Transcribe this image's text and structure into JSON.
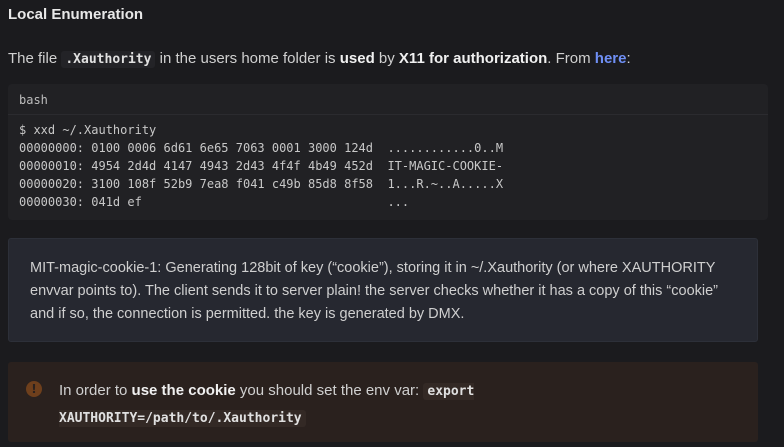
{
  "section": {
    "title": "Local Enumeration"
  },
  "intro": {
    "t1": "The file ",
    "code": ".Xauthority",
    "t2": " in the users home folder is ",
    "b1": "used",
    "t3": " by ",
    "b2": "X11 for authorization",
    "t4": ". From ",
    "link": "here",
    "t5": ":"
  },
  "codeblock": {
    "language": "bash",
    "lines": [
      "$ xxd ~/.Xauthority",
      "00000000: 0100 0006 6d61 6e65 7063 0001 3000 124d  ............0..M",
      "00000010: 4954 2d4d 4147 4943 2d43 4f4f 4b49 452d  IT-MAGIC-COOKIE-",
      "00000020: 3100 108f 52b9 7ea8 f041 c49b 85d8 8f58  1...R.~..A.....X",
      "00000030: 041d ef                                  ..."
    ]
  },
  "info": {
    "text": "MIT-magic-cookie-1: Generating 128bit of key (“cookie”), storing it in ~/.Xauthority (or where XAUTHORITY envvar points to). The client sends it to server plain! the server checks whether it has a copy of this “cookie” and if so, the connection is permitted. the key is generated by DMX."
  },
  "warning": {
    "icon": "exclamation-circle-icon",
    "t1": "In order to ",
    "bold": "use the cookie",
    "t2": " you should set the env var: ",
    "code": "export XAUTHORITY=/path/to/.Xauthority"
  },
  "colors": {
    "background": "#1b1b1e",
    "link": "#6f8ff5",
    "info_bg": "#262830",
    "warning_bg": "#2a211e",
    "warning_icon": "#6e3f1c"
  }
}
